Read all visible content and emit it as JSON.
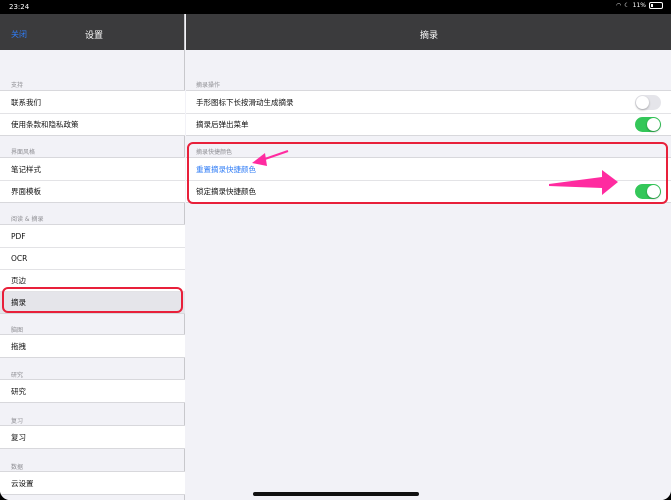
{
  "status_bar": {
    "time": "23:24",
    "battery": "11%"
  },
  "sidebar": {
    "close_label": "关闭",
    "title": "设置",
    "sections": [
      {
        "header": "支持",
        "items": [
          "联系我们",
          "使用条款和隐私政策"
        ]
      },
      {
        "header": "界面风格",
        "items": [
          "笔记样式",
          "界面模板"
        ]
      },
      {
        "header": "阅读 & 摘录",
        "items": [
          "PDF",
          "OCR",
          "页边",
          "摘录"
        ]
      },
      {
        "header": "脑图",
        "items": [
          "拖拽"
        ]
      },
      {
        "header": "研究",
        "items": [
          "研究"
        ]
      },
      {
        "header": "复习",
        "items": [
          "复习"
        ]
      },
      {
        "header": "数据",
        "items": [
          "云设置"
        ]
      }
    ],
    "selected_item": "摘录"
  },
  "detail": {
    "title": "摘录",
    "sections": [
      {
        "header": "摘录操作",
        "rows": [
          {
            "label": "手形图标下长按滑动生成摘录",
            "toggle": false
          },
          {
            "label": "摘录后弹出菜单",
            "toggle": true
          }
        ]
      },
      {
        "header": "摘录快捷颜色",
        "rows": [
          {
            "label": "重置摘录快捷颜色",
            "link": true
          },
          {
            "label": "锁定摘录快捷颜色",
            "toggle": true
          }
        ]
      }
    ]
  },
  "colors": {
    "accent": "#2f7cf6",
    "toggle_on": "#34c759",
    "annotation": "#e8203a",
    "arrow": "#ff2ba0"
  }
}
